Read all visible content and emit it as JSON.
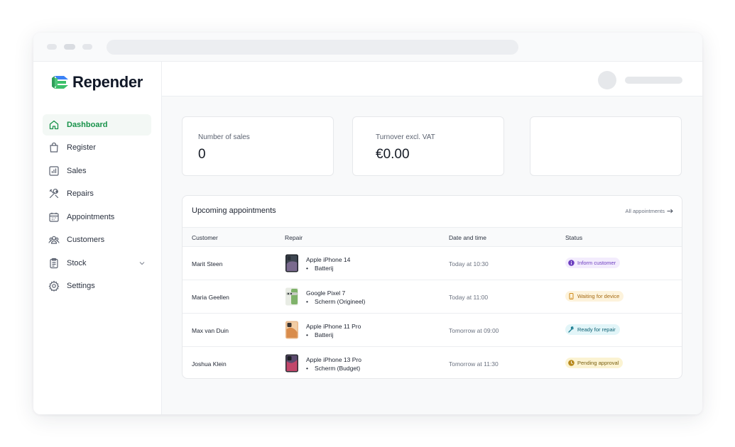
{
  "app": {
    "name": "Repender"
  },
  "sidebar": {
    "items": [
      {
        "label": "Dashboard",
        "icon": "home-icon",
        "active": true
      },
      {
        "label": "Register",
        "icon": "shopping-bag-icon"
      },
      {
        "label": "Sales",
        "icon": "bar-chart-icon"
      },
      {
        "label": "Repairs",
        "icon": "tools-icon"
      },
      {
        "label": "Appointments",
        "icon": "calendar-icon"
      },
      {
        "label": "Customers",
        "icon": "users-icon"
      },
      {
        "label": "Stock",
        "icon": "clipboard-icon",
        "has_submenu": true
      },
      {
        "label": "Settings",
        "icon": "gear-icon"
      }
    ]
  },
  "stats": [
    {
      "label": "Number of sales",
      "value": "0"
    },
    {
      "label": "Turnover excl. VAT",
      "value": "€0.00"
    }
  ],
  "appointments": {
    "title": "Upcoming appointments",
    "all_link": "All appointments",
    "columns": [
      "Customer",
      "Repair",
      "Date and time",
      "Status"
    ],
    "rows": [
      {
        "customer": "Marit Steen",
        "device": "Apple iPhone 14",
        "repair": "Batterij",
        "datetime": "Today at 10:30",
        "status": "Inform customer",
        "status_icon": "info-icon",
        "status_color": "#7c3aed",
        "status_bg": "#f3ecfd"
      },
      {
        "customer": "Maria Geellen",
        "device": "Google Pixel 7",
        "repair": "Scherm (Origineel)",
        "datetime": "Today at 11:00",
        "status": "Waiting for device",
        "status_icon": "phone-icon",
        "status_color": "#b7791f",
        "status_bg": "#fdf3dc"
      },
      {
        "customer": "Max van Duin",
        "device": "Apple iPhone 11 Pro",
        "repair": "Batterij",
        "datetime": "Tomorrow at 09:00",
        "status": "Ready for repair",
        "status_icon": "wrench-icon",
        "status_color": "#0e7490",
        "status_bg": "#e2f5f8"
      },
      {
        "customer": "Joshua Klein",
        "device": "Apple iPhone 13 Pro",
        "repair": "Scherm (Budget)",
        "datetime": "Tomorrow at 11:30",
        "status": "Pending approval",
        "status_icon": "clock-icon",
        "status_color": "#8a6d12",
        "status_bg": "#fbf3d2"
      }
    ]
  },
  "colors": {
    "accent": "#17924a",
    "logo_green": "#3cc06a",
    "logo_blue": "#3b82f6"
  }
}
